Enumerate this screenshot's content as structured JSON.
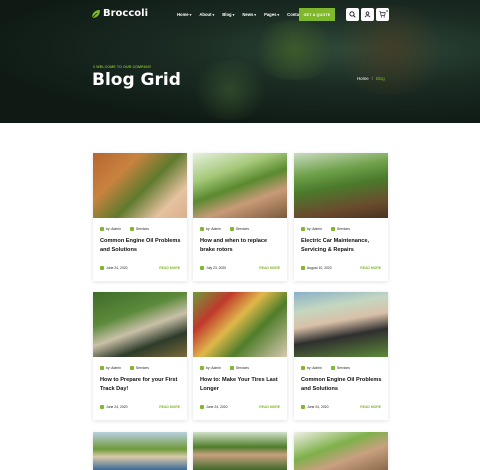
{
  "brand": {
    "name": "Broccoli",
    "accent": "#7fb82b"
  },
  "nav": [
    {
      "label": "Home",
      "dropdown": true
    },
    {
      "label": "About",
      "dropdown": true
    },
    {
      "label": "Blog",
      "dropdown": true
    },
    {
      "label": "News",
      "dropdown": true
    },
    {
      "label": "Pages",
      "dropdown": true
    },
    {
      "label": "Contact",
      "dropdown": false
    }
  ],
  "header": {
    "quote_label": "GET A QUOTE",
    "cart_count": "0"
  },
  "hero": {
    "welcome": "// WELCOME TO OUR COMPANY",
    "title": "Blog Grid",
    "breadcrumb": {
      "home": "Home",
      "sep": "/",
      "current": "Blog"
    }
  },
  "posts": [
    {
      "author": "by: Admin",
      "category": "Services",
      "title": "Common Engine Oil Problems and Solutions",
      "date": "June 24, 2020",
      "more": "READ MORE"
    },
    {
      "author": "by: Admin",
      "category": "Services",
      "title": "How and when to replace brake rotors",
      "date": "July 23, 2020",
      "more": "READ MORE"
    },
    {
      "author": "by: Admin",
      "category": "Services",
      "title": "Electric Car Maintenance, Servicing & Repairs",
      "date": "August 10, 2020",
      "more": "READ MORE"
    },
    {
      "author": "by: Admin",
      "category": "Services",
      "title": "How to Prepare for your First Track Day!",
      "date": "June 24, 2020",
      "more": "READ MORE"
    },
    {
      "author": "by: Admin",
      "category": "Services",
      "title": "How to: Make Your Tires Last Longer",
      "date": "June 24, 2020",
      "more": "READ MORE"
    },
    {
      "author": "by: Admin",
      "category": "Services",
      "title": "Common Engine Oil Problems and Solutions",
      "date": "June 24, 2020",
      "more": "READ MORE"
    }
  ]
}
